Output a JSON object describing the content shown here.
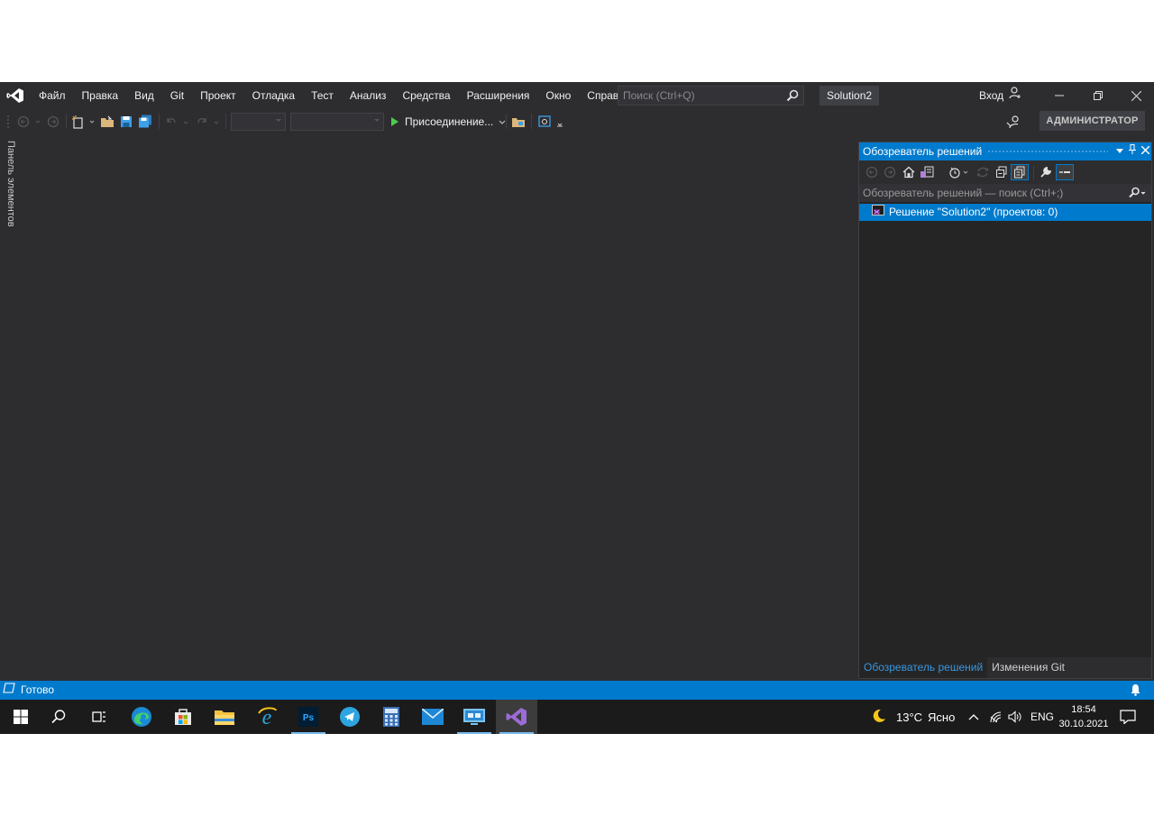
{
  "menubar": {
    "items": [
      "Файл",
      "Правка",
      "Вид",
      "Git",
      "Проект",
      "Отладка",
      "Тест",
      "Анализ",
      "Средства",
      "Расширения",
      "Окно",
      "Справка"
    ],
    "search_placeholder": "Поиск (Ctrl+Q)",
    "solution_name": "Solution2",
    "login_label": "Вход"
  },
  "toolbar": {
    "attach_label": "Присоединение...",
    "admin_label": "АДМИНИСТРАТОР"
  },
  "toolbox": {
    "label": "Панель элементов"
  },
  "solution_explorer": {
    "title": "Обозреватель решений",
    "search_placeholder": "Обозреватель решений — поиск (Ctrl+;)",
    "root_item": "Решение \"Solution2\"  (проектов: 0)",
    "tabs": [
      "Обозреватель решений",
      "Изменения Git"
    ]
  },
  "statusbar": {
    "text": "Готово"
  },
  "taskbar": {
    "weather_temp": "13°C",
    "weather_text": "Ясно",
    "lang": "ENG",
    "time": "18:54",
    "date": "30.10.2021"
  },
  "colors": {
    "accent": "#007acc",
    "background": "#2d2d30",
    "panel": "#252526",
    "taskbar": "#1b1b1b"
  }
}
